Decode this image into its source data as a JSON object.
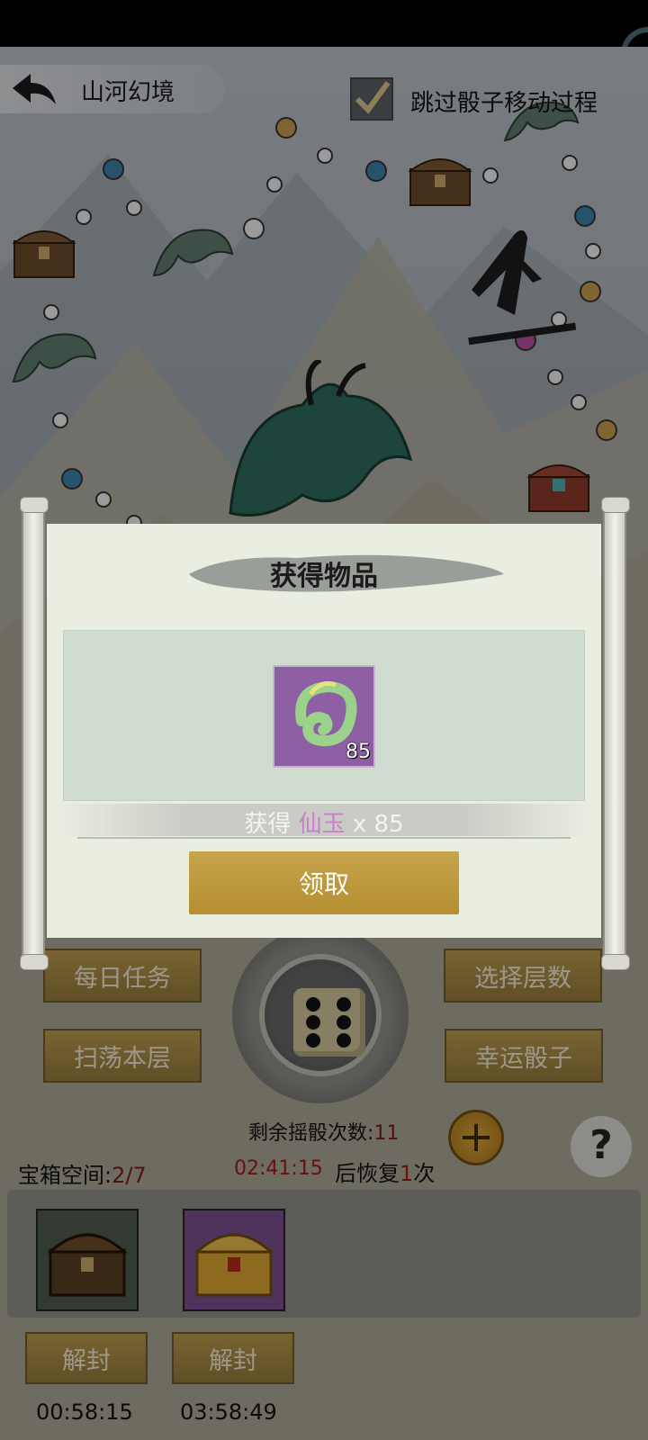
{
  "header": {
    "realm_title": "山河幻境",
    "skip_label": "跳过骰子移动过程",
    "skip_checked": true
  },
  "menu_buttons": {
    "daily_tasks": "每日任务",
    "select_floor": "选择层数",
    "sweep_floor": "扫荡本层",
    "lucky_dice": "幸运骰子"
  },
  "dice": {
    "face": 6,
    "remaining_label": "剩余摇骰次数:",
    "remaining_count": "11",
    "recover_timer": "02:41:15",
    "recover_prefix": "后恢复",
    "recover_amount": "1",
    "recover_suffix": "次"
  },
  "chest_space": {
    "label": "宝箱空间:",
    "value": "2/7"
  },
  "chest_slots": [
    {
      "type": "wooden-chest",
      "unseal_label": "解封",
      "timer": "00:58:15"
    },
    {
      "type": "golden-chest",
      "unseal_label": "解封",
      "timer": "03:58:49"
    }
  ],
  "dialog": {
    "title": "获得物品",
    "item_name": "仙玉",
    "item_qty": "85",
    "obtain_prefix": "获得",
    "obtain_qty": "x 85",
    "claim_label": "领取"
  },
  "colors": {
    "gold_button": "#b99a4e",
    "item_purple": "#8e5fa3",
    "item_name_color": "#d07ad3",
    "alert_red": "#a11a17"
  }
}
